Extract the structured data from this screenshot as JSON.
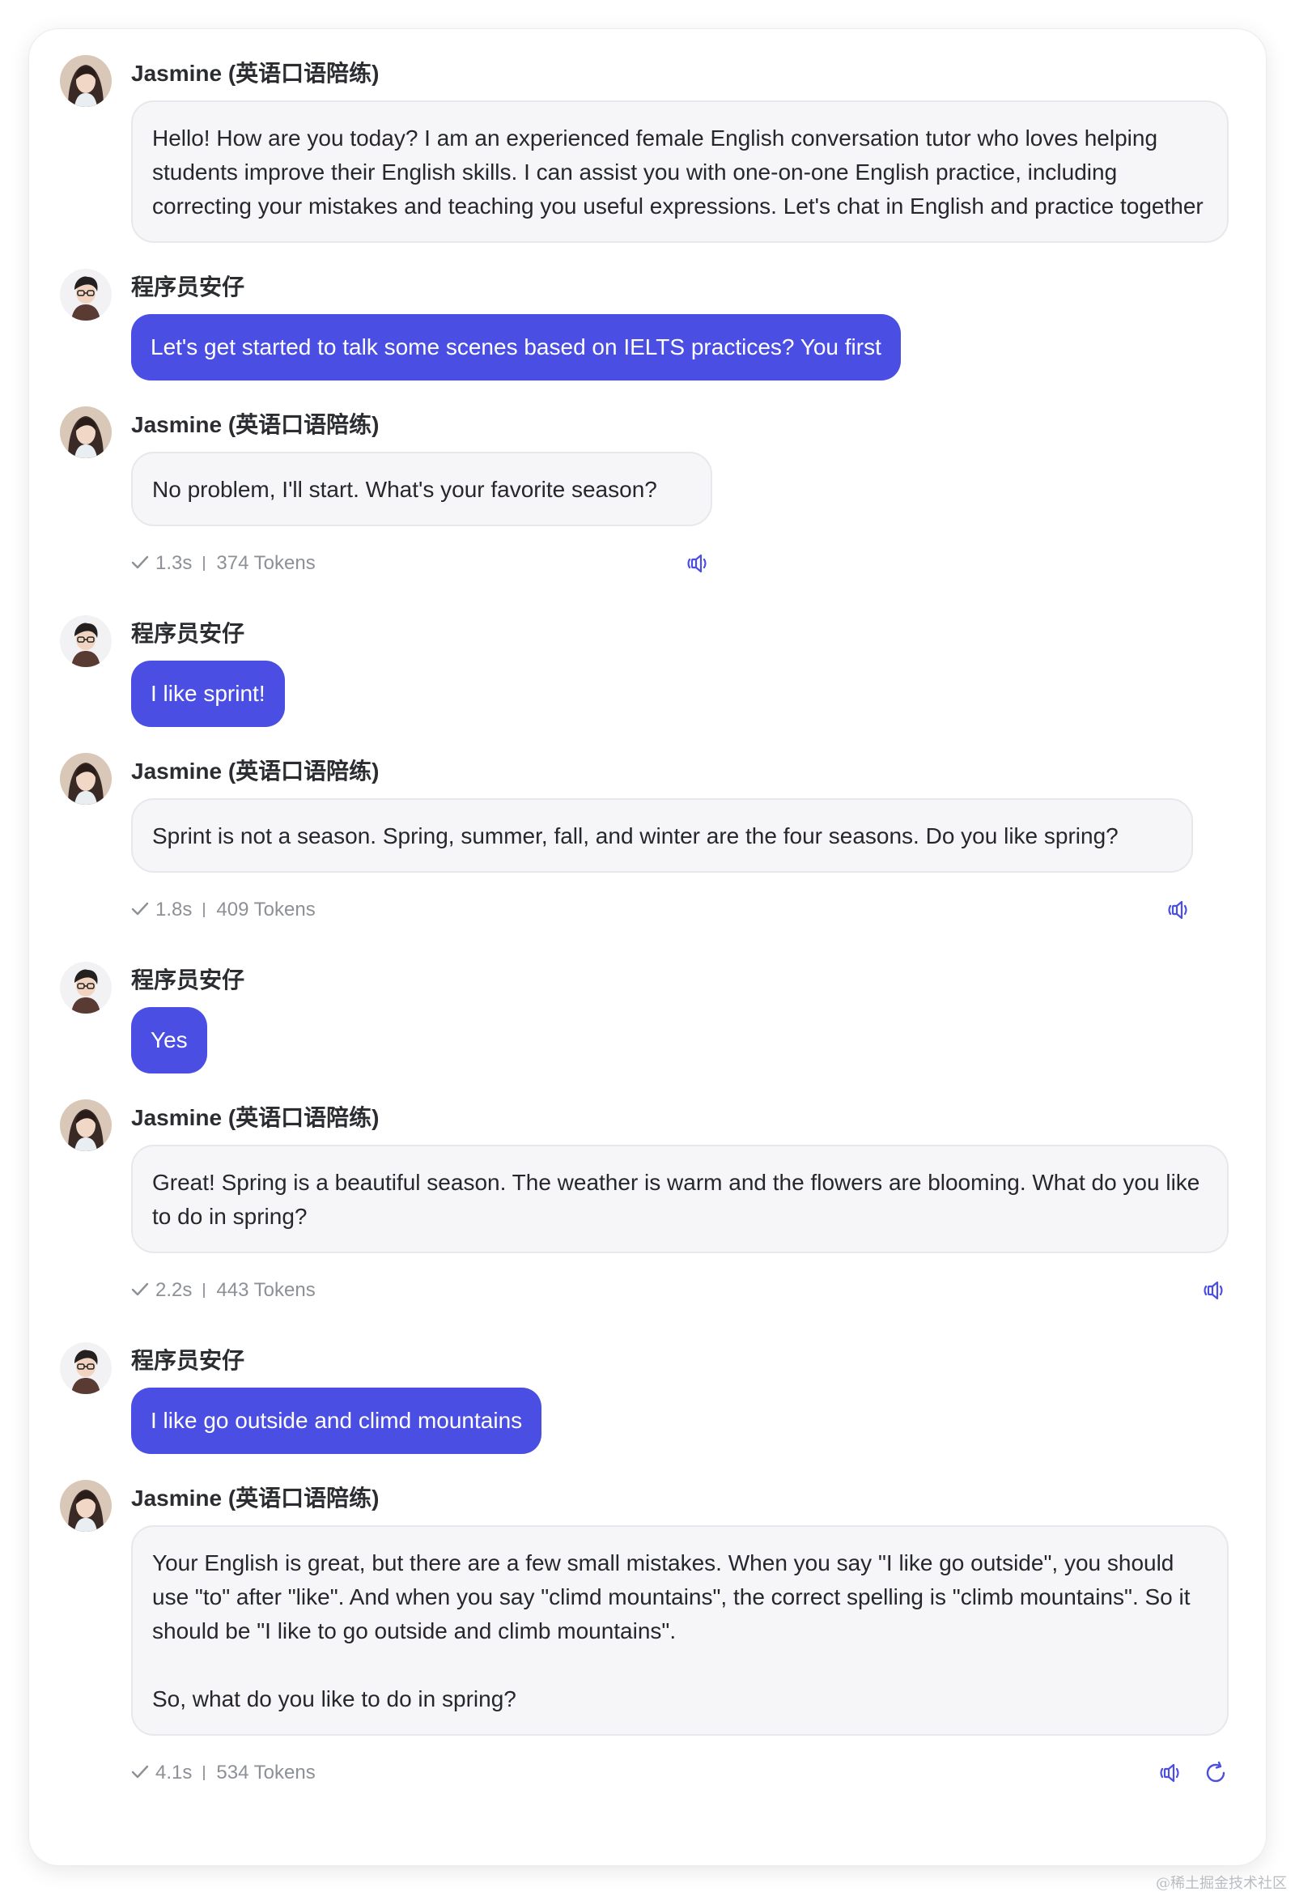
{
  "colors": {
    "user_bubble": "#4b4ee3",
    "bot_bubble": "#f6f6f8",
    "icon_accent": "#4b4ee3",
    "meta_text": "#8d9096"
  },
  "messages": [
    {
      "role": "bot",
      "name": "Jasmine (英语口语陪练)",
      "avatar": "jasmine-avatar",
      "text": "Hello! How are you today? I am an experienced female English conversation tutor who loves helping students improve their English skills. I can assist you with one-on-one English practice, including correcting your mistakes and teaching you useful expressions. Let's chat in English and practice together"
    },
    {
      "role": "user",
      "name": "程序员安仔",
      "avatar": "anzai-avatar",
      "text": "Let's get started to talk some scenes based on IELTS practices? You first"
    },
    {
      "role": "bot",
      "name": "Jasmine (英语口语陪练)",
      "avatar": "jasmine-avatar",
      "text": "No problem, I'll start. What's your favorite season?",
      "time": "1.3s",
      "tokens": "374 Tokens",
      "icons": [
        "speaker-icon"
      ]
    },
    {
      "role": "user",
      "name": "程序员安仔",
      "avatar": "anzai-avatar",
      "text": "I like sprint!"
    },
    {
      "role": "bot",
      "name": "Jasmine (英语口语陪练)",
      "avatar": "jasmine-avatar",
      "text": "Sprint is not a season. Spring, summer, fall, and winter are the four seasons. Do you like spring?",
      "time": "1.8s",
      "tokens": "409 Tokens",
      "icons": [
        "speaker-icon"
      ]
    },
    {
      "role": "user",
      "name": "程序员安仔",
      "avatar": "anzai-avatar",
      "text": "Yes"
    },
    {
      "role": "bot",
      "name": "Jasmine (英语口语陪练)",
      "avatar": "jasmine-avatar",
      "text": "Great! Spring is a beautiful season. The weather is warm and the flowers are blooming. What do you like to do in spring?",
      "time": "2.2s",
      "tokens": "443 Tokens",
      "icons": [
        "speaker-icon"
      ]
    },
    {
      "role": "user",
      "name": "程序员安仔",
      "avatar": "anzai-avatar",
      "text": "I like go outside and climd mountains"
    },
    {
      "role": "bot",
      "name": "Jasmine (英语口语陪练)",
      "avatar": "jasmine-avatar",
      "text": "Your English is great, but there are a few small mistakes. When you say \"I like go outside\", you should use \"to\" after \"like\". And when you say \"climd mountains\", the correct spelling is \"climb mountains\". So it should be \"I like to go outside and climb mountains\".\n\nSo, what do you like to do in spring?",
      "time": "4.1s",
      "tokens": "534 Tokens",
      "icons": [
        "speaker-icon",
        "regenerate-icon"
      ]
    }
  ],
  "watermark": "@稀土掘金技术社区"
}
